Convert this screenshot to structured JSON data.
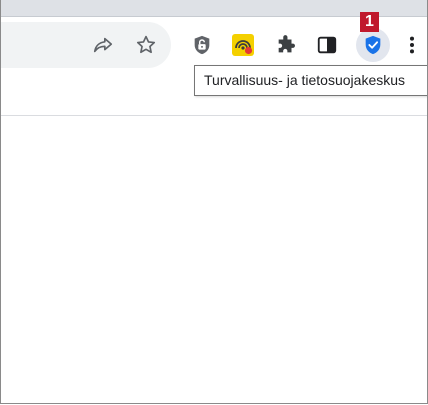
{
  "toolbar": {
    "share_icon": "share-icon",
    "bookmark_icon": "star-icon",
    "extensions": [
      {
        "name": "lock-extension-icon"
      },
      {
        "name": "yellow-extension-icon"
      },
      {
        "name": "puzzle-icon"
      }
    ],
    "side_panel_icon": "side-panel-icon",
    "security_icon": "shield-check-icon",
    "menu_icon": "kebab-menu-icon",
    "badge_number": "1",
    "tooltip_text": "Turvallisuus- ja tietosuojakeskus"
  },
  "colors": {
    "accent_blue": "#1a73e8",
    "badge_red": "#c0182c",
    "yellow_ext": "#f4d000"
  }
}
